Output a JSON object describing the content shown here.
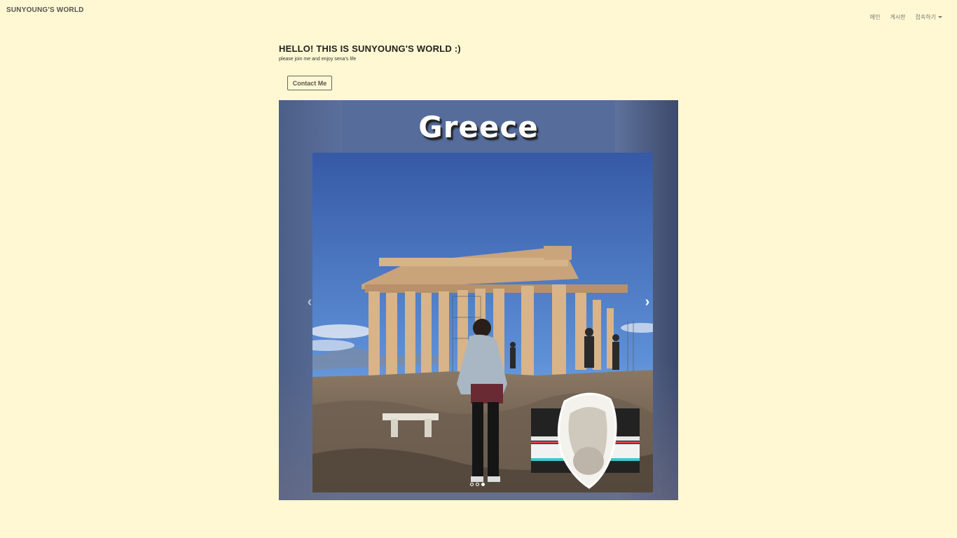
{
  "navbar": {
    "brand": "SUNYOUNG'S WORLD",
    "menu": [
      {
        "label": "메인"
      },
      {
        "label": "게시판"
      },
      {
        "label": "접속하기"
      }
    ]
  },
  "jumbotron": {
    "title": "HELLO! THIS IS SUNYOUNG'S WORLD :)",
    "subtitle": "please join me and enjoy sena's life",
    "contact_label": "Contact Me"
  },
  "carousel": {
    "slide_title": "Greece",
    "prev_glyph": "‹",
    "next_glyph": "›",
    "indicator_count": 3,
    "active_index": 2,
    "colors": {
      "sky": "#3d6cb8",
      "frame": "#566d9c",
      "stone": "#c9a37a"
    }
  }
}
